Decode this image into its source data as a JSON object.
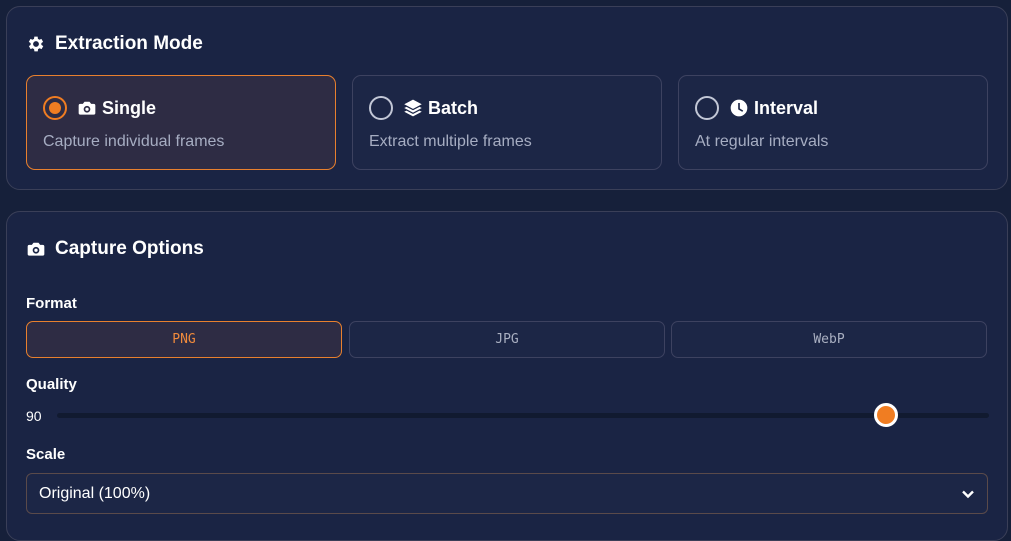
{
  "extraction_mode": {
    "title": "Extraction Mode",
    "title_icon": "gear-icon",
    "options": [
      {
        "label": "Single",
        "description": "Capture individual frames",
        "icon": "camera-icon",
        "selected": true
      },
      {
        "label": "Batch",
        "description": "Extract multiple frames",
        "icon": "layers-icon",
        "selected": false
      },
      {
        "label": "Interval",
        "description": "At regular intervals",
        "icon": "clock-icon",
        "selected": false
      }
    ]
  },
  "capture_options": {
    "title": "Capture Options",
    "title_icon": "camera-icon",
    "format": {
      "label": "Format",
      "options": [
        "PNG",
        "JPG",
        "WebP"
      ],
      "selected": "PNG"
    },
    "quality": {
      "label": "Quality",
      "value": "90",
      "min": 0,
      "max": 100
    },
    "scale": {
      "label": "Scale",
      "selected": "Original (100%)"
    }
  },
  "colors": {
    "accent": "#f07d22",
    "background": "#16203a",
    "panel": "#1a2444",
    "muted_text": "#a6adc2"
  }
}
